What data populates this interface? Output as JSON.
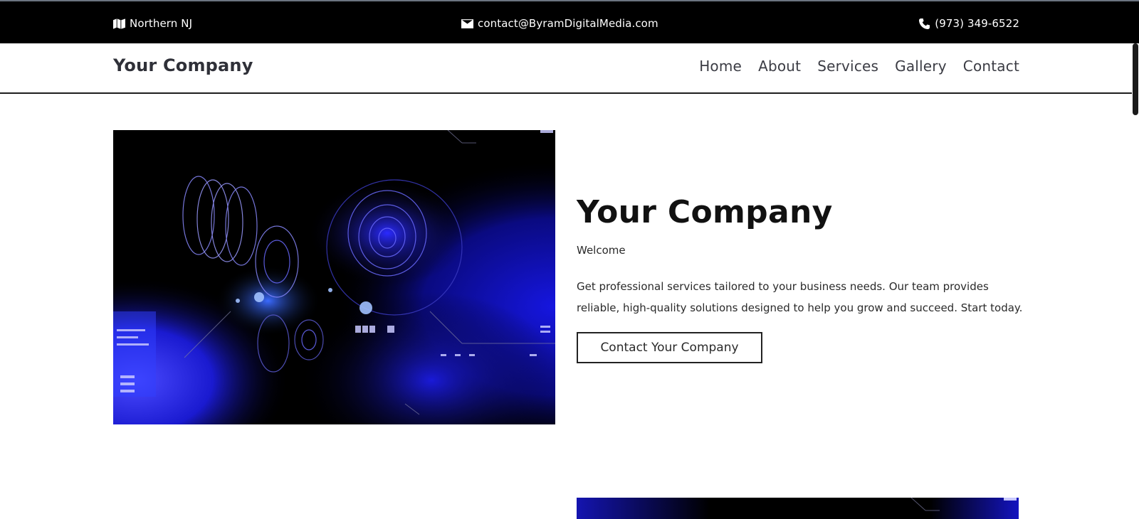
{
  "topbar": {
    "location": {
      "icon": "map-icon",
      "text": "Northern NJ"
    },
    "email": {
      "icon": "envelope-icon",
      "text": "contact@ByramDigitalMedia.com"
    },
    "phone": {
      "icon": "phone-icon",
      "text": "(973) 349-6522"
    }
  },
  "header": {
    "brand": "Your Company",
    "nav": [
      "Home",
      "About",
      "Services",
      "Gallery",
      "Contact"
    ]
  },
  "hero": {
    "image": "abstract-blue-technology-image",
    "title": "Your Company",
    "subtitle": "Welcome",
    "description": "Get professional services tailored to your business needs. Our team provides reliable, high-quality solutions designed to help you grow and succeed. Start today.",
    "cta_label": "Contact Your Company"
  },
  "colors": {
    "topbar_bg": "#000000",
    "text_dark": "#111111",
    "accent_blue": "#1a1aff"
  }
}
